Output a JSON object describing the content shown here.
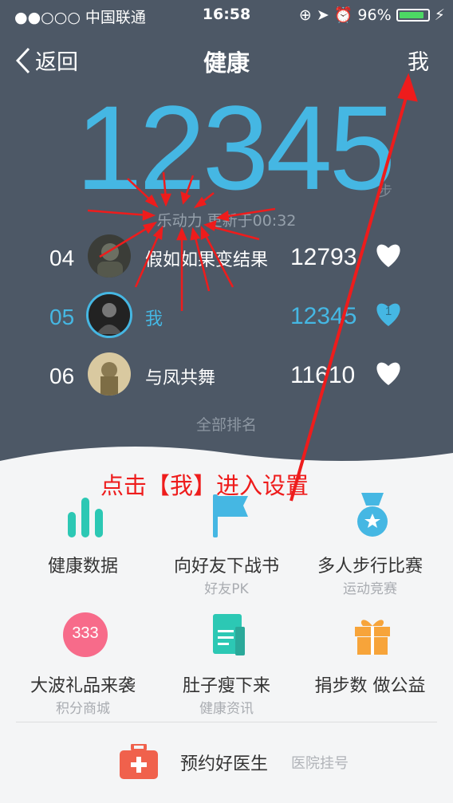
{
  "status_bar": {
    "carrier": "●●○○○ 中国联通",
    "time": "16:58",
    "battery": "96%"
  },
  "nav": {
    "back_label": "返回",
    "title": "健康",
    "me_label": "我"
  },
  "steps": {
    "value": "12345",
    "unit": "步",
    "updated": "乐动力 更新于00:32"
  },
  "ranking": [
    {
      "rank": "04",
      "name": "假如如果变结果",
      "score": "12793",
      "likes": ""
    },
    {
      "rank": "05",
      "name": "我",
      "score": "12345",
      "likes": "1"
    },
    {
      "rank": "06",
      "name": "与凤共舞",
      "score": "11610",
      "likes": ""
    }
  ],
  "all_rank_label": "全部排名",
  "annotation": "点击【我】进入设置",
  "features": [
    {
      "title": "健康数据",
      "subtitle": "",
      "icon": "bar-chart-icon"
    },
    {
      "title": "向好友下战书",
      "subtitle": "好友PK",
      "icon": "flag-icon"
    },
    {
      "title": "多人步行比赛",
      "subtitle": "运动竞赛",
      "icon": "medal-icon"
    },
    {
      "title": "大波礼品来袭",
      "subtitle": "积分商城",
      "icon": "points-icon",
      "icon_text": "333"
    },
    {
      "title": "肚子瘦下来",
      "subtitle": "健康资讯",
      "icon": "document-icon"
    },
    {
      "title": "捐步数 做公益",
      "subtitle": "",
      "icon": "gift-icon"
    }
  ],
  "doctor": {
    "title": "预约好医生",
    "subtitle": "医院挂号",
    "icon": "medical-kit-icon"
  },
  "colors": {
    "accent": "#45b7e3",
    "header_bg": "#4d5866",
    "annotation": "#ee1c1c",
    "teal": "#2cc8b4",
    "pink": "#f76b8a",
    "orange": "#f7a43a",
    "red": "#f0614c"
  }
}
